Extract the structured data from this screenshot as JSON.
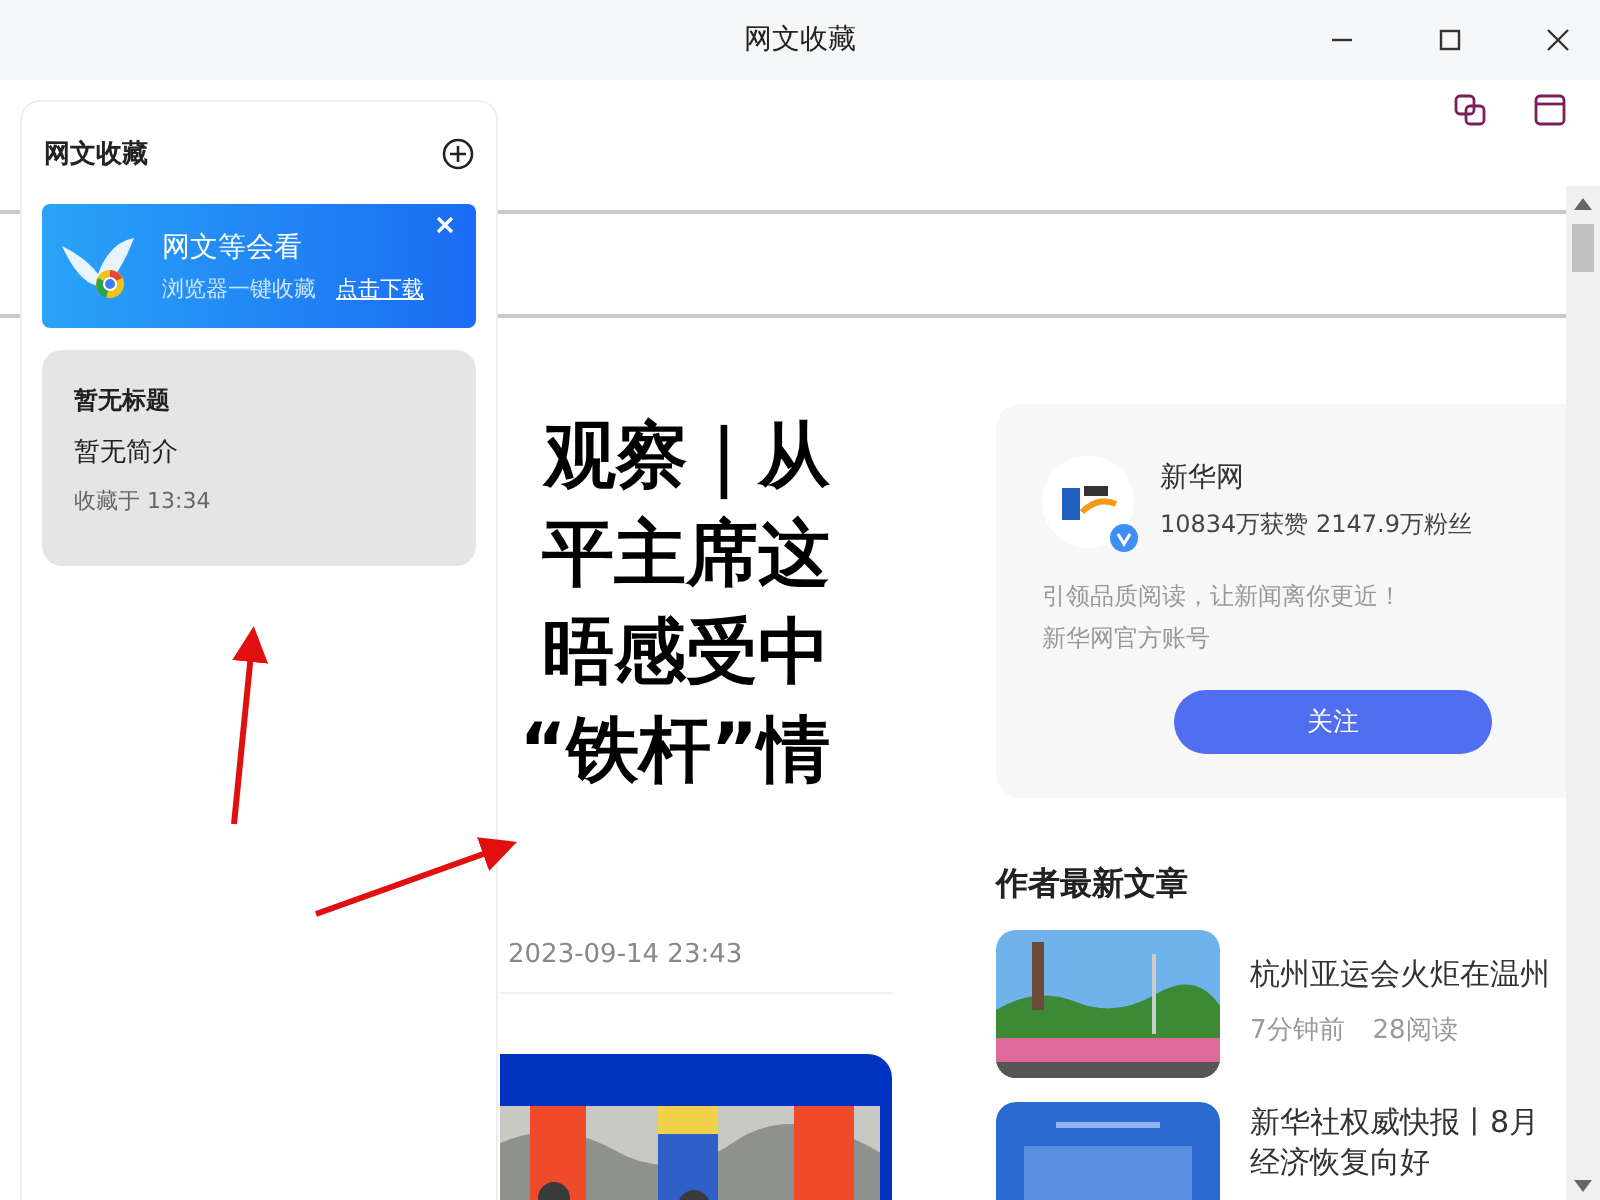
{
  "window": {
    "title": "网文收藏"
  },
  "sidebar": {
    "title": "网文收藏",
    "promo": {
      "title": "网文等会看",
      "subtitle": "浏览器一键收藏",
      "link": "点击下载"
    },
    "items": [
      {
        "title": "暂无标题",
        "summary": "暂无简介",
        "saved_time": "收藏于 13:34"
      }
    ]
  },
  "article": {
    "headline_lines": [
      "观察｜从",
      "平主席这",
      "晤感受中",
      "“铁杆”情"
    ],
    "date": "2023-09-14 23:43"
  },
  "author": {
    "name": "新华网",
    "verified": true,
    "stats": "10834万获赞 2147.9万粉丝",
    "description_lines": [
      "引领品质阅读，让新闻离你更近！",
      "新华网官方账号"
    ],
    "follow_button": "关注"
  },
  "latest": {
    "heading": "作者最新文章",
    "articles": [
      {
        "title_lines": [
          "杭州亚运会火炬在温州"
        ],
        "time": "7分钟前",
        "reads": "28阅读"
      },
      {
        "title_lines": [
          "新华社权威快报丨8月",
          "经济恢复向好"
        ]
      }
    ]
  }
}
